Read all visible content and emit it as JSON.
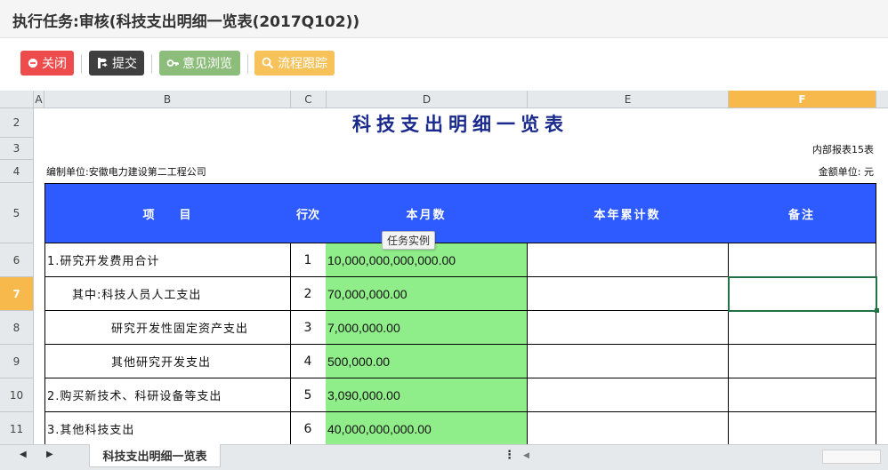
{
  "title": "执行任务:审核(科技支出明细一览表(2017Q102))",
  "toolbar": {
    "close": "关闭",
    "submit": "提交",
    "opinion": "意见浏览",
    "flow": "流程跟踪",
    "colors": {
      "close": "#ee4c4c",
      "submit": "#3f3f3f",
      "opinion": "#8cbd7a",
      "flow": "#f8c25a"
    }
  },
  "columns": [
    "A",
    "B",
    "C",
    "D",
    "E",
    "F"
  ],
  "selected_column": "F",
  "rows": [
    "2",
    "3",
    "4",
    "5",
    "6",
    "7",
    "8",
    "9",
    "10",
    "11"
  ],
  "selected_row": "7",
  "report": {
    "title": "科技支出明细一览表",
    "report_no": "内部报表15表",
    "unit": "编制单位:安徽电力建设第二工程公司",
    "currency": "金额单位: 元",
    "headers": {
      "item": "项    目",
      "line": "行次",
      "month": "本月数",
      "ytd": "本年累计数",
      "remark": "备注"
    },
    "items": [
      {
        "item": "1.研究开发费用合计",
        "line": "1",
        "month": "10,000,000,000,000.00",
        "ytd": "",
        "remark": ""
      },
      {
        "item": "其中:科技人员人工支出",
        "line": "2",
        "month": "70,000,000.00",
        "ytd": "",
        "remark": ""
      },
      {
        "item": "研究开发性固定资产支出",
        "line": "3",
        "month": "7,000,000.00",
        "ytd": "",
        "remark": ""
      },
      {
        "item": "其他研究开发支出",
        "line": "4",
        "month": "500,000.00",
        "ytd": "",
        "remark": ""
      },
      {
        "item": "2.购买新技术、科研设备等支出",
        "line": "5",
        "month": "3,090,000.00",
        "ytd": "",
        "remark": ""
      },
      {
        "item": "3.其他科技支出",
        "line": "6",
        "month": "40,000,000,000.00",
        "ytd": "",
        "remark": ""
      }
    ]
  },
  "tooltip": "任务实例",
  "sheet_tab": "科技支出明细一览表",
  "colors": {
    "header_blue": "#2e5bff",
    "value_green": "#90ee8a",
    "selection_orange": "#f7b94c"
  }
}
